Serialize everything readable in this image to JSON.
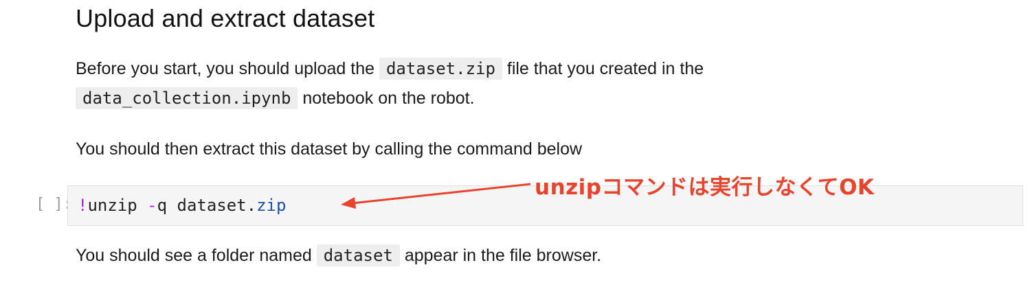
{
  "heading": "Upload and extract dataset",
  "para1": {
    "t1": "Before you start, you should upload the ",
    "code1": "dataset.zip",
    "t2": " file that you created in the",
    "code2": "data_collection.ipynb",
    "t3": " notebook on the robot."
  },
  "para2": "You should then extract this dataset by calling the command below",
  "cell": {
    "prompt": "[ ]:",
    "code": {
      "bang": "!",
      "cmd": "unzip ",
      "flag_op": "-",
      "flag": "q dataset.",
      "ext": "zip"
    }
  },
  "para3": {
    "t1": "You should see a folder named ",
    "code": "dataset",
    "t2": " appear in the file browser."
  },
  "annotation": {
    "text": "unzipコマンドは実行しなくてOK",
    "color": "#e8432d"
  }
}
